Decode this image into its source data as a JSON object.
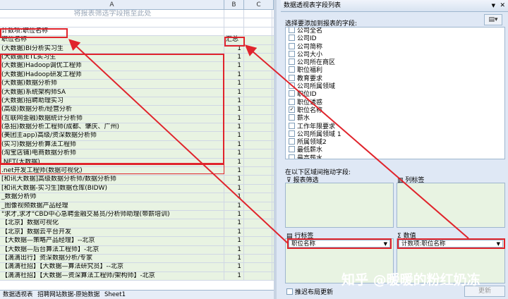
{
  "sheet": {
    "columns": [
      "A",
      "B",
      "C"
    ],
    "drop_hint": "将报表筛选字段拖至此处",
    "filter_row": "计数项:职位名称",
    "header_row": {
      "label": "职位名称",
      "sum": "汇总"
    },
    "rows": [
      "(大数据)BI分析实习生",
      "(大数据)ETL实习生",
      "(大数据)Hadoop调优工程师",
      "(大数据)Hadoop研发工程师",
      "(大数据)数据分析师",
      "(大数据)系统架构师SA",
      "(大数据)招聘助理实习",
      "(高级)数据分析/经营分析",
      "(互联网金融)数据统计分析师",
      "(急招)数据分析工程师(成都、肇庆、广州)",
      "(美团主app)高级/资深数据分析师",
      "(实习)数据分析算法工程师",
      "(淘宝店铺)电商数据分析师",
      ".NET(大数据)",
      ".net开发工程师(数据可视化)",
      "[和讯大数据]高级数据分析师/数据分析师",
      "[和讯大数据-实习生]数据仓库(BIDW)",
      "_数据分析师",
      "_图像视频数据产品经理",
      "\"求才,求才\"CBD中心急聘金融交易员/分析师助理(带薪培训)",
      "【北京】数据可视化",
      "【北京】数据云平台开发",
      "【大数据—策略产品经理】--北京",
      "【大数据—后台算法工程师】-北京",
      "【滴滴出行】资深数据分析/专家",
      "【滴滴社招】【大数据—算法研究员】--北京",
      "【滴滴社招】【大数据—资深算法工程师/架构师】-北京"
    ],
    "value": "1",
    "tabs": [
      "数据透视表",
      "招聘网站数据-原始数据",
      "Sheet1"
    ]
  },
  "panel": {
    "title": "数据透视表字段列表",
    "choose_label": "选择要添加到报表的字段:",
    "fields": [
      {
        "name": "公司全名",
        "checked": false
      },
      {
        "name": "公司ID",
        "checked": false
      },
      {
        "name": "公司简称",
        "checked": false
      },
      {
        "name": "公司大小",
        "checked": false
      },
      {
        "name": "公司所在商区",
        "checked": false
      },
      {
        "name": "职位福利",
        "checked": false
      },
      {
        "name": "教育要求",
        "checked": false
      },
      {
        "name": "公司所属领域",
        "checked": false
      },
      {
        "name": "职位ID",
        "checked": false
      },
      {
        "name": "职位诱惑",
        "checked": false
      },
      {
        "name": "职位名称",
        "checked": true
      },
      {
        "name": "薪水",
        "checked": false
      },
      {
        "name": "工作年限要求",
        "checked": false
      },
      {
        "name": "公司所属领域 1",
        "checked": false
      },
      {
        "name": "所属领域2",
        "checked": false
      },
      {
        "name": "最低薪水",
        "checked": false
      },
      {
        "name": "最高薪水",
        "checked": false
      }
    ],
    "drag_label": "在以下区域间拖动字段:",
    "filter_area": "报表筛选",
    "col_area": "列标签",
    "row_area": "行标签",
    "value_area": "数值",
    "row_field": "职位名称",
    "value_field": "计数项:职位名称",
    "defer_label": "推迟布局更新",
    "update_btn": "更新"
  },
  "watermark": "知乎 @暖暖的粉红奶冻"
}
